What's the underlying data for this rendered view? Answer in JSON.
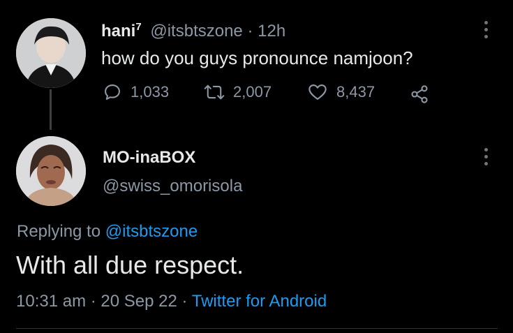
{
  "colors": {
    "background": "#000000",
    "text_primary": "#e7e9ea",
    "text_secondary": "#8b98a5",
    "link": "#1d9bf0",
    "divider": "#2f3336"
  },
  "tweet": {
    "display_name": "hani",
    "name_superscript": "7",
    "handle": "@itsbtszone",
    "separator": "·",
    "time": "12h",
    "text": "how do you guys pronounce namjoon?",
    "replies": "1,033",
    "retweets": "2,007",
    "likes": "8,437",
    "icons": {
      "more": "more-horizontal-icon",
      "reply": "reply-bubble-icon",
      "retweet": "retweet-arrows-icon",
      "like": "heart-icon",
      "share": "share-nodes-icon"
    }
  },
  "reply": {
    "display_name": "MO-inaBOX",
    "handle": "@swiss_omorisola",
    "replying_prefix": "Replying to",
    "replying_handle": "@itsbtszone",
    "text": "With all due respect.",
    "time": "10:31 am",
    "date": "20 Sep 22",
    "source": "Twitter for Android",
    "separator": "·",
    "icons": {
      "more": "more-horizontal-icon"
    }
  }
}
